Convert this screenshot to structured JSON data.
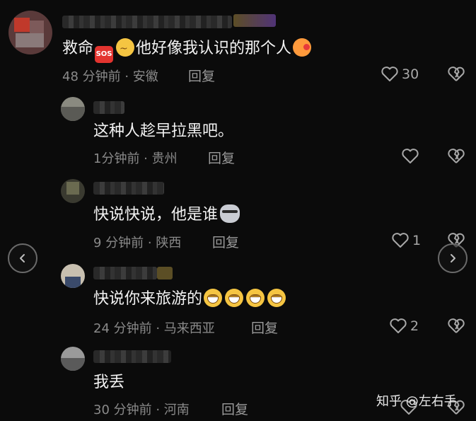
{
  "comments": [
    {
      "text": "救命",
      "text_after_sos": "他好像我认识的那个人",
      "time": "48 分钟前 · 安徽",
      "reply_label": "回复",
      "likes": "30"
    },
    {
      "text": "这种人趁早拉黑吧。",
      "time": "1分钟前 · 贵州",
      "reply_label": "回复",
      "likes": ""
    },
    {
      "text": "快说快说，他是谁",
      "time": "9 分钟前 · 陕西",
      "reply_label": "回复",
      "likes": "1"
    },
    {
      "text": "快说你来旅游的",
      "time": "24 分钟前 · 马来西亚",
      "reply_label": "回复",
      "likes": "2"
    },
    {
      "text": "我丢",
      "time": "30 分钟前 · 河南",
      "reply_label": "回复",
      "likes": ""
    }
  ],
  "sos_badge": "SOS",
  "watermark": "知乎 @左右手",
  "icons": {
    "like": "heart-outline-icon",
    "dislike": "broken-heart-icon",
    "prev": "chevron-left-icon",
    "next": "chevron-right-icon"
  }
}
